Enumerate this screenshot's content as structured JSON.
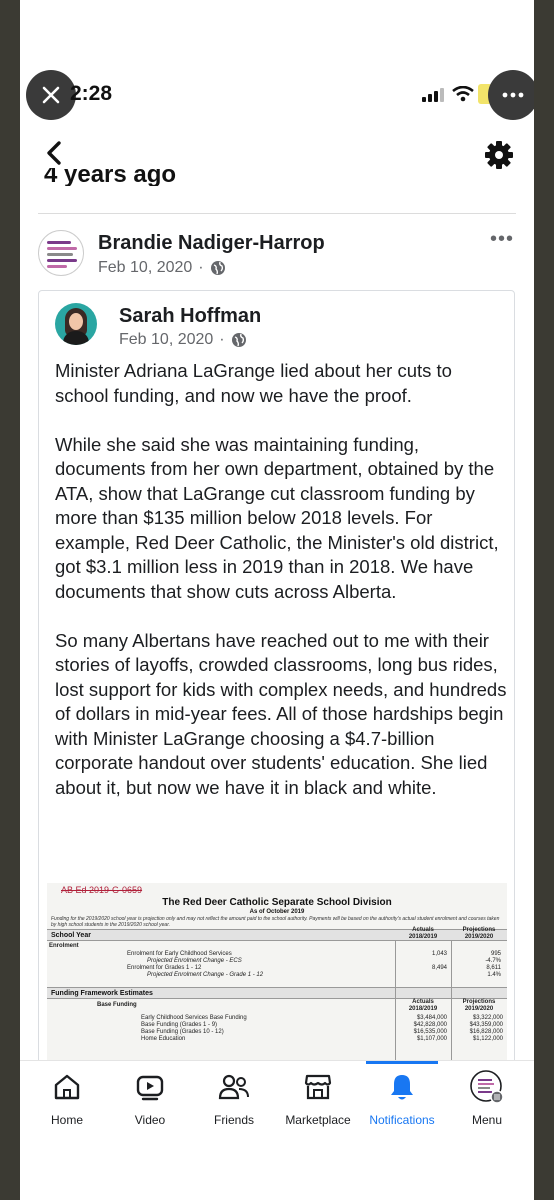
{
  "status_bar": {
    "time": "2:28"
  },
  "page": {
    "header_partial": "4 years ago"
  },
  "outer_post": {
    "author": "Brandie Nadiger-Harrop",
    "date": "Feb 10, 2020",
    "separator": "·"
  },
  "shared_post": {
    "author": "Sarah Hoffman",
    "date": "Feb 10, 2020",
    "separator": "·",
    "paragraphs": [
      "Minister Adriana LaGrange lied about her cuts to school funding, and now we have the proof.",
      "While she said she was maintaining funding, documents from her own department, obtained by the ATA, show that LaGrange cut classroom funding by more than $135 million below 2018 levels. For example, Red Deer Catholic, the Minister's old district, got $3.1 million less in 2019 than in 2018. We have documents that show cuts across Alberta.",
      "So many Albertans have reached out to me with their stories of layoffs, crowded classrooms, long bus rides, lost support for kids with complex needs, and hundreds of dollars in mid-year fees. All of those hardships begin with Minister LaGrange choosing a $4.7-billion corporate handout over students' education. She lied about it, but now we have it in black and white."
    ]
  },
  "document": {
    "stamp": "AB Ed 2019-G-0659",
    "title": "The Red Deer Catholic Separate School Division",
    "subtitle": "As of October 2019",
    "note": "Funding for the 2019/2020 school year is projection only and may not reflect the amount paid to the school authority. Payments will be based on the authority's actual student enrolment and courses taken by high school students in the 2019/2020 school year.",
    "section1": "School Year",
    "enrolment_label": "Enrolment",
    "col_actuals": "Actuals",
    "col_actuals_year": "2018/2019",
    "col_proj": "Projections",
    "col_proj_year": "2019/2020",
    "enrol_rows": [
      {
        "label": "Enrolment for Early Childhood Services",
        "actual": "1,043",
        "proj": "995"
      },
      {
        "label": "Projected Enrolment Change - ECS",
        "actual": "",
        "proj": "-4.7%"
      },
      {
        "label": "Enrolment for Grades 1 - 12",
        "actual": "8,494",
        "proj": "8,611"
      },
      {
        "label": "Projected Enrolment Change - Grade 1 - 12",
        "actual": "",
        "proj": "1.4%"
      }
    ],
    "section2": "Funding Framework Estimates",
    "base_funding": "Base Funding",
    "fund_rows": [
      {
        "label": "Early Childhood Services Base Funding",
        "actual": "$3,484,000",
        "proj": "$3,322,000"
      },
      {
        "label": "Base Funding (Grades 1 - 9)",
        "actual": "$42,828,000",
        "proj": "$43,359,000"
      },
      {
        "label": "Base Funding (Grades 10 - 12)",
        "actual": "$16,535,000",
        "proj": "$16,828,000"
      },
      {
        "label": "Home Education",
        "actual": "$1,107,000",
        "proj": "$1,122,000"
      }
    ]
  },
  "tabs": [
    {
      "label": "Home",
      "icon": "home-icon"
    },
    {
      "label": "Video",
      "icon": "video-icon"
    },
    {
      "label": "Friends",
      "icon": "friends-icon"
    },
    {
      "label": "Marketplace",
      "icon": "marketplace-icon"
    },
    {
      "label": "Notifications",
      "icon": "bell-icon",
      "active": true
    },
    {
      "label": "Menu",
      "icon": "menu-avatar-icon"
    }
  ],
  "colors": {
    "accent": "#1877f2",
    "text": "#1c1e21",
    "muted": "#65676b",
    "frame": "#3b3a33"
  }
}
